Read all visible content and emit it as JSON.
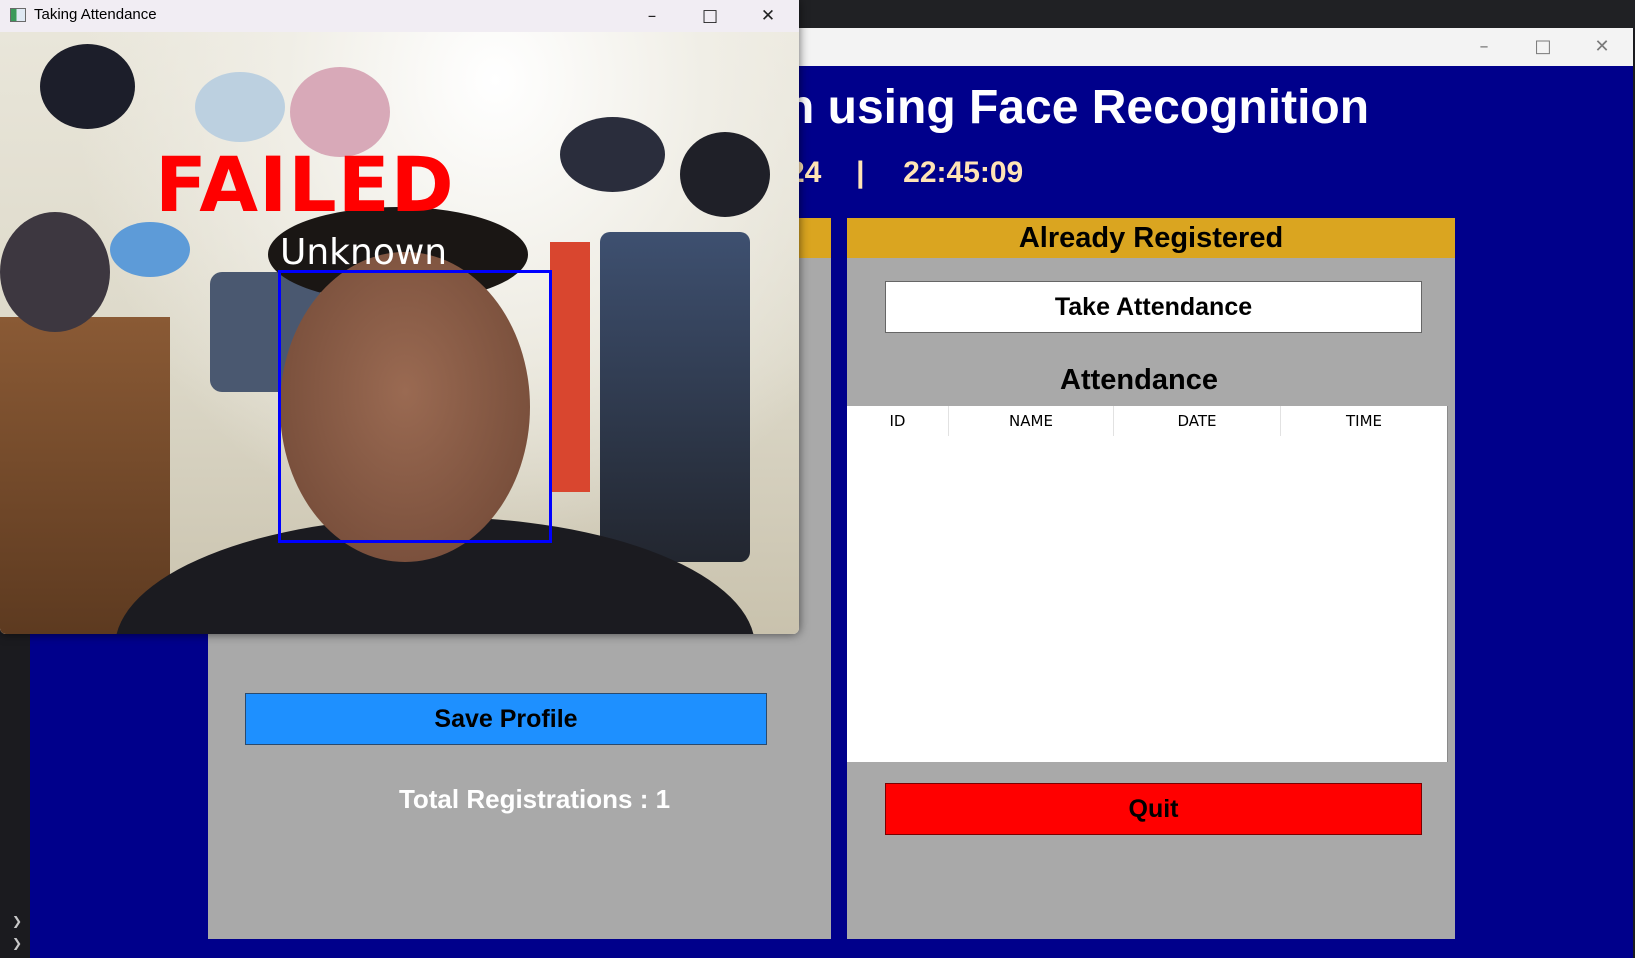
{
  "main_window": {
    "title": "n using Face Recognition",
    "date_fragment": "24",
    "separator": "|",
    "time": "22:45:09",
    "caption_buttons": [
      "minimize-icon",
      "maximize-icon",
      "close-icon"
    ]
  },
  "left_panel": {
    "save_profile_label": "Save Profile",
    "total_registrations": "Total Registrations : 1"
  },
  "right_panel": {
    "header": "Already Registered",
    "take_attendance_label": "Take Attendance",
    "attendance_label": "Attendance",
    "table_columns": [
      "ID",
      "NAME",
      "DATE",
      "TIME"
    ],
    "table_rows": [],
    "quit_label": "Quit"
  },
  "camera_window": {
    "title": "Taking Attendance",
    "status_text": "FAILED",
    "face_label": "Unknown"
  },
  "colors": {
    "main_bg": "#00008b",
    "panel_bg": "#a9a9a9",
    "header_gold": "#daa520",
    "save_blue": "#1e90ff",
    "quit_red": "#ff0000",
    "clock_text": "#ffe4b5",
    "face_box": "#0000ff"
  }
}
